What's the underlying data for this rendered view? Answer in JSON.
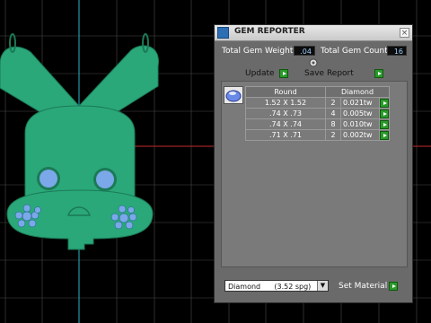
{
  "panel": {
    "title": "GEM REPORTER",
    "close_glyph": "×",
    "total_weight_label": "Total Gem Weight",
    "total_weight_value": ".04",
    "total_count_label": "Total Gem Count",
    "total_count_value": "16",
    "update_label": "Update",
    "save_report_label": "Save Report"
  },
  "table": {
    "headers": [
      "Round",
      "Diamond"
    ],
    "rows": [
      {
        "size": "1.52 X 1.52",
        "count": "2",
        "weight": "0.021tw"
      },
      {
        "size": ".74 X .73",
        "count": "4",
        "weight": "0.005tw"
      },
      {
        "size": ".74 X .74",
        "count": "8",
        "weight": "0.010tw"
      },
      {
        "size": ".71 X .71",
        "count": "2",
        "weight": "0.002tw"
      }
    ]
  },
  "material": {
    "selected": "Diamond      (3.52 spg)",
    "set_material_label": "Set Material"
  },
  "colors": {
    "model_green": "#2aa87a",
    "gem_blue": "#7aa8e8",
    "grid": "#4a4a4a",
    "axis_cyan": "#27b3c6",
    "axis_red": "#c42a2a"
  }
}
